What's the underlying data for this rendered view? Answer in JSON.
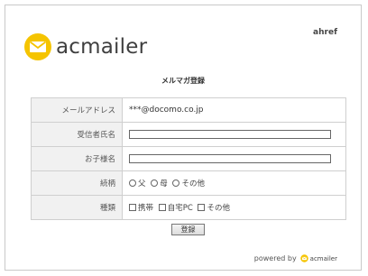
{
  "header": {
    "logo_text": "acmailer",
    "brand_link": "ahref",
    "brand_color": "#f5c400"
  },
  "page_title": "メルマガ登録",
  "form": {
    "rows": {
      "email": {
        "label": "メールアドレス",
        "value": "***@docomo.co.jp"
      },
      "recipient_name": {
        "label": "受信者氏名",
        "value": ""
      },
      "child_name": {
        "label": "お子様名",
        "value": ""
      },
      "relationship": {
        "label": "続柄",
        "options": [
          "父",
          "母",
          "その他"
        ],
        "selected": null
      },
      "type": {
        "label": "種類",
        "options": [
          "携帯",
          "自宅PC",
          "その他"
        ],
        "checked": []
      }
    },
    "submit_label": "登録"
  },
  "footer": {
    "powered_by": "powered by",
    "brand": "acmailer"
  },
  "icons": {
    "logo": "envelope-icon",
    "footer_logo": "envelope-icon"
  }
}
